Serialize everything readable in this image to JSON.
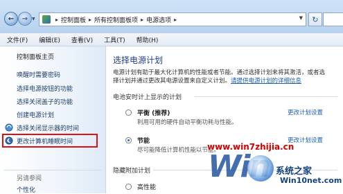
{
  "address_bar": {
    "crumbs": [
      "控制面板",
      "所有控制面板项",
      "电源选项"
    ]
  },
  "menu": [
    "文件(F)",
    "编辑(E)",
    "查看(V)",
    "工具(T)",
    "帮助(H)"
  ],
  "left_pane": {
    "home": "控制面板主页",
    "links": [
      "唤醒时需要密码",
      "选择电源按钮的功能",
      "选择关闭盖子的功能",
      "创建电源计划",
      "选择关闭显示器的时间",
      "更改计算机睡眠时间"
    ],
    "see_also": "另请参阅",
    "see_also_links": [
      "个性化"
    ]
  },
  "main": {
    "title": "选择电源计划",
    "desc_line1": "电源计划有助于最大化计算机的性能或者节能。通过选择计划来将其激活，或者选",
    "desc_line2_pre": "择计划并通过更改其电源设置来自定义计划。",
    "desc_link": "请提供电源计划的详细信息",
    "battery_section": "电池安时计上显示的计划",
    "plans": [
      {
        "name": "平衡 (推荐)",
        "desc": "利用可用的硬件自动平衡功耗与性能。",
        "link": "更改计划设置",
        "selected": false
      },
      {
        "name": "节能",
        "desc": "尽可能降低计算机性能以节能。",
        "link": "更改计划设置",
        "selected": true
      }
    ],
    "hidden_section": "隐藏附加计划",
    "hidden_plans": [
      {
        "name": "高性能"
      }
    ]
  },
  "watermark": {
    "url": "www.win7zhijia.cn",
    "win": "Win",
    "brand": "系统之家",
    "brand_site": "Win10net.com"
  },
  "colors": {
    "accent": "#1f3a93",
    "link": "#1a5fb4",
    "highlight": "#e01010"
  }
}
